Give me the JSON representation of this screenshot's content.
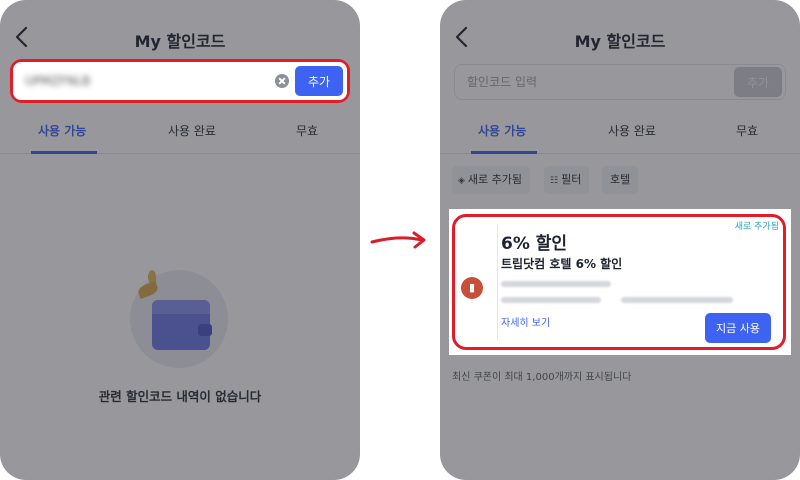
{
  "left_screen": {
    "title": "My 할인코드",
    "search": {
      "value": "UPMZFNLB",
      "add_label": "추가"
    },
    "tabs": [
      {
        "label": "사용 가능",
        "active": true
      },
      {
        "label": "사용 완료",
        "active": false
      },
      {
        "label": "무효",
        "active": false
      }
    ],
    "empty_message": "관련 할인코드 내역이 없습니다"
  },
  "right_screen": {
    "title": "My 할인코드",
    "search": {
      "placeholder": "할인코드 입력",
      "add_label": "추가"
    },
    "tabs": [
      {
        "label": "사용 가능",
        "active": true
      },
      {
        "label": "사용 완료",
        "active": false
      },
      {
        "label": "무효",
        "active": false
      }
    ],
    "filters": [
      {
        "icon": "new-icon",
        "label": "새로 추가됨"
      },
      {
        "icon": "filter-icon",
        "label": "필터"
      },
      {
        "icon": "",
        "label": "호텔"
      }
    ],
    "coupon": {
      "badge": "새로 추가됨",
      "discount": "6% 할인",
      "name": "트립닷컴 호텔 6% 할인",
      "details_label": "자세히 보기",
      "use_label": "지금 사용"
    },
    "footnote": "최신 쿠폰이 최대 1,000개까지 표시됩니다"
  },
  "colors": {
    "accent": "#3e63f3",
    "highlight": "#e11d2a",
    "new_badge": "#28a4c8",
    "hotel_icon": "#c8503a"
  }
}
